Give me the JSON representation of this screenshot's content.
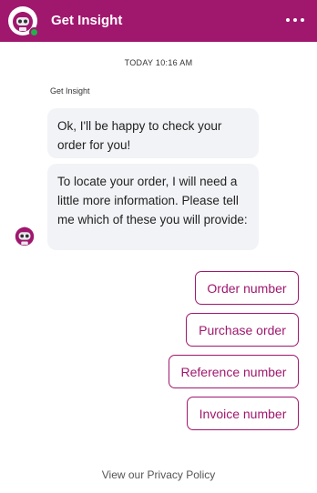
{
  "header": {
    "title": "Get Insight",
    "status": "online",
    "menu_icon": "more-horizontal-icon",
    "accent_color": "#a0176e",
    "status_color": "#21b04b"
  },
  "chat": {
    "timestamp": "TODAY 10:16 AM",
    "sender": "Get Insight",
    "messages": [
      {
        "text": "Ok, I'll be happy to check your order for you!"
      },
      {
        "text": "To locate your order, I will need a little more information. Please tell me which of these you will provide:"
      }
    ],
    "options": [
      {
        "label": "Order number"
      },
      {
        "label": "Purchase order"
      },
      {
        "label": "Reference number"
      },
      {
        "label": "Invoice number"
      }
    ]
  },
  "footer": {
    "privacy_link": "View our Privacy Policy"
  }
}
